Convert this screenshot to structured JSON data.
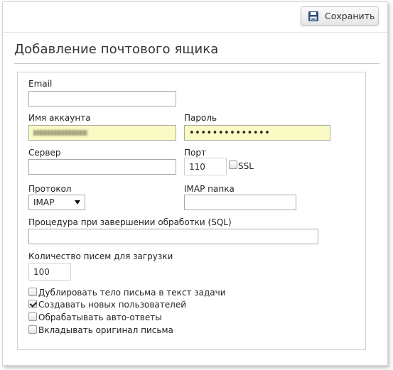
{
  "toolbar": {
    "save_label": "Сохранить",
    "save_icon": "save-icon"
  },
  "page_title": "Добавление почтового ящика",
  "form": {
    "email": {
      "label": "Email",
      "value": ""
    },
    "account_name": {
      "label": "Имя аккаунта"
    },
    "password": {
      "label": "Пароль",
      "value": "••••••••••••••"
    },
    "server": {
      "label": "Сервер",
      "value": ""
    },
    "port": {
      "label": "Порт",
      "value": "110"
    },
    "ssl": {
      "label": "SSL",
      "checked": false
    },
    "protocol": {
      "label": "Протокол",
      "selected": "IMAP"
    },
    "imap_folder": {
      "label": "IMAP папка",
      "value": ""
    },
    "procedure": {
      "label": "Процедура при завершении обработки (SQL)",
      "value": ""
    },
    "letters_count": {
      "label": "Количество писем для загрузки",
      "value": "100"
    }
  },
  "options": [
    {
      "label": "Дублировать тело письма в текст задачи",
      "checked": false
    },
    {
      "label": "Создавать новых пользователей",
      "checked": true
    },
    {
      "label": "Обрабатывать авто-ответы",
      "checked": false
    },
    {
      "label": "Вкладывать оригинал письма",
      "checked": false
    }
  ],
  "colors": {
    "autofill": "#fafbc4",
    "accent_icon": "#2f4f7f"
  }
}
